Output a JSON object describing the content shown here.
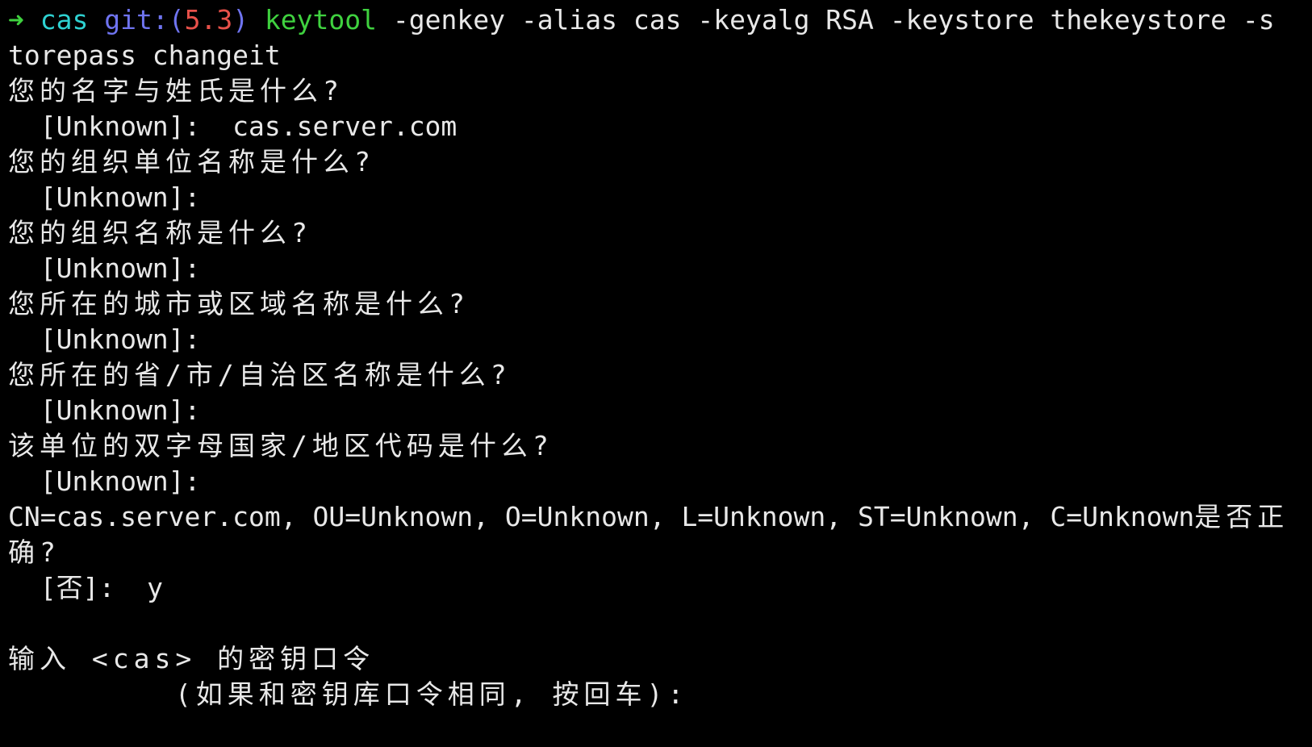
{
  "colors": {
    "background": "#000000",
    "text": "#e8e8e8",
    "prompt_arrow": "#3fd13f",
    "prompt_dir": "#2ed1d1",
    "prompt_git": "#6f74f0",
    "prompt_branch": "#e8514a",
    "command": "#3fd13f"
  },
  "prompt": {
    "arrow": "➜",
    "dir": "cas",
    "git_label": "git:(",
    "branch": "5.3",
    "git_close": ")",
    "command": "keytool",
    "args_line1": " -genkey -alias cas -keyalg RSA -keystore thekeystore -s",
    "args_line2": "torepass changeit"
  },
  "output": {
    "q_name": "您的名字与姓氏是什么?",
    "a_name": "  [Unknown]:  cas.server.com",
    "q_org_unit": "您的组织单位名称是什么?",
    "a_org_unit": "  [Unknown]:",
    "q_org": "您的组织名称是什么?",
    "a_org": "  [Unknown]:",
    "q_city": "您所在的城市或区域名称是什么?",
    "a_city": "  [Unknown]:",
    "q_state": "您所在的省/市/自治区名称是什么?",
    "a_state": "  [Unknown]:",
    "q_country": "该单位的双字母国家/地区代码是什么?",
    "a_country": "  [Unknown]:",
    "confirm_dn": "CN=cas.server.com, OU=Unknown, O=Unknown, L=Unknown, ST=Unknown, C=Unknown",
    "confirm_suffix_1": "是否正",
    "confirm_suffix_2": "确?",
    "confirm_answer": "  [否]:  y",
    "key_pass_prompt": "输入 <cas> 的密钥口令",
    "key_pass_hint": "        (如果和密钥库口令相同, 按回车):"
  }
}
